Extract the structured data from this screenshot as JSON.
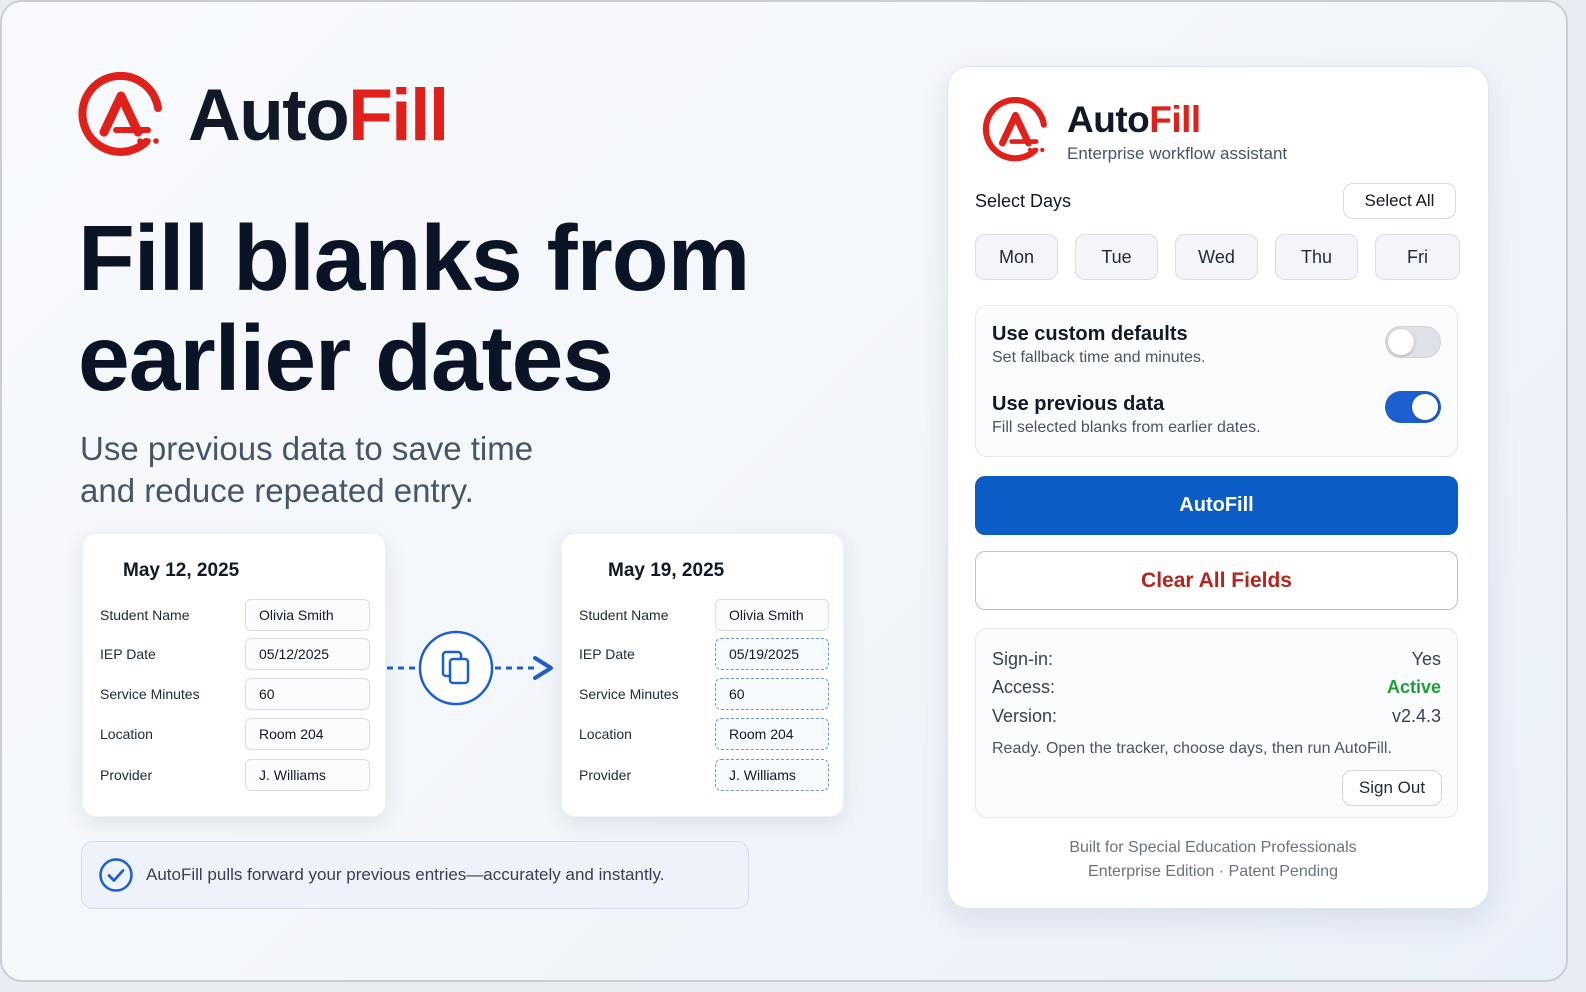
{
  "hero": {
    "brand_auto": "Auto",
    "brand_fill": "Fill",
    "headline_line1": "Fill blanks from",
    "headline_line2": "earlier dates",
    "sub_line1": "Use previous data to save time",
    "sub_line2": "and reduce repeated entry."
  },
  "records": [
    {
      "date": "May 12, 2025",
      "fields": [
        {
          "label": "Student Name",
          "value": "Olivia Smith"
        },
        {
          "label": "IEP Date",
          "value": "05/12/2025"
        },
        {
          "label": "Service Minutes",
          "value": "60"
        },
        {
          "label": "Location",
          "value": "Room 204"
        },
        {
          "label": "Provider",
          "value": "J. Williams"
        }
      ]
    },
    {
      "date": "May 19, 2025",
      "fields": [
        {
          "label": "Student Name",
          "value": "Olivia Smith"
        },
        {
          "label": "IEP Date",
          "value": "05/19/2025"
        },
        {
          "label": "Service Minutes",
          "value": "60"
        },
        {
          "label": "Location",
          "value": "Room 204"
        },
        {
          "label": "Provider",
          "value": "J. Williams"
        }
      ]
    }
  ],
  "banner": {
    "text": "AutoFill pulls forward your previous entries—accurately and instantly."
  },
  "panel": {
    "brand_auto": "Auto",
    "brand_fill": "Fill",
    "tagline": "Enterprise workflow assistant",
    "select_days_label": "Select Days",
    "select_all_label": "Select All",
    "days": [
      "Mon",
      "Tue",
      "Wed",
      "Thu",
      "Fri"
    ],
    "options": [
      {
        "title": "Use custom defaults",
        "desc": "Set fallback time and minutes.",
        "enabled": false
      },
      {
        "title": "Use previous data",
        "desc": "Fill selected blanks from earlier dates.",
        "enabled": true
      }
    ],
    "autofill_label": "AutoFill",
    "clear_label": "Clear All Fields",
    "status": {
      "signin_label": "Sign-in:",
      "signin_value": "Yes",
      "access_label": "Access:",
      "access_value": "Active",
      "version_label": "Version:",
      "version_value": "v2.4.3",
      "message": "Ready. Open the tracker, choose days, then run AutoFill."
    },
    "signout_label": "Sign Out",
    "footer_line1": "Built for Special Education Professionals",
    "footer_line2": "Enterprise Edition · Patent Pending"
  },
  "colors": {
    "brand_red": "#e0201b",
    "primary_blue": "#0b5cc5",
    "active_green": "#1e9e3a",
    "clear_red": "#b3261e"
  },
  "icons": [
    "autofill-logo-icon",
    "copy-icon",
    "arrow-right-icon",
    "check-circle-icon"
  ]
}
